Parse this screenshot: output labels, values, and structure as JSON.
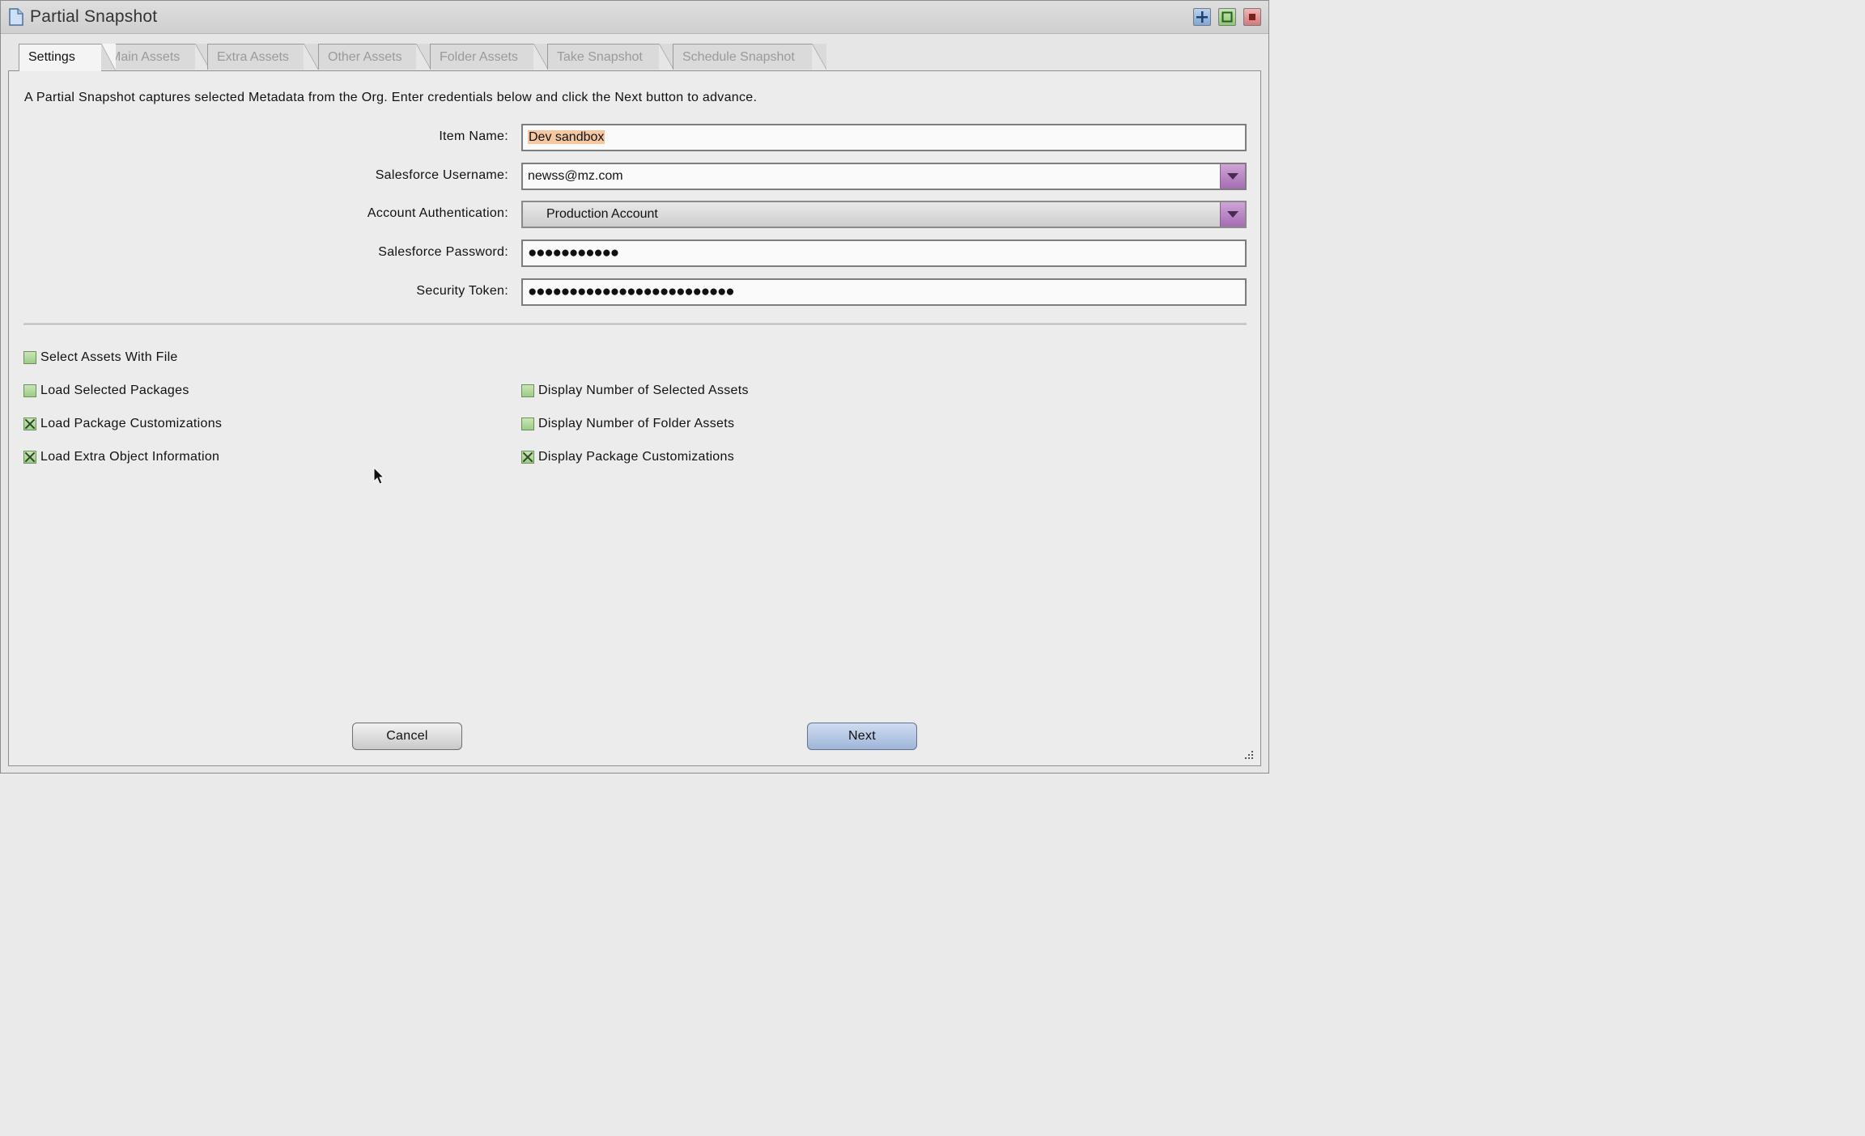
{
  "window": {
    "title": "Partial Snapshot"
  },
  "tabs": [
    {
      "label": "Settings",
      "active": true
    },
    {
      "label": "Main Assets",
      "active": false
    },
    {
      "label": "Extra Assets",
      "active": false
    },
    {
      "label": "Other Assets",
      "active": false
    },
    {
      "label": "Folder Assets",
      "active": false
    },
    {
      "label": "Take Snapshot",
      "active": false
    },
    {
      "label": "Schedule Snapshot",
      "active": false
    }
  ],
  "intro": "A Partial Snapshot captures selected Metadata from the Org. Enter credentials below and click the Next button to advance.",
  "form": {
    "item_name": {
      "label": "Item Name:",
      "value": "Dev sandbox"
    },
    "username": {
      "label": "Salesforce Username:",
      "value": "newss@mz.com"
    },
    "auth": {
      "label": "Account Authentication:",
      "value": "Production Account"
    },
    "password": {
      "label": "Salesforce Password:",
      "value": "●●●●●●●●●●●"
    },
    "token": {
      "label": "Security Token:",
      "value": "●●●●●●●●●●●●●●●●●●●●●●●●●"
    }
  },
  "options": {
    "select_assets_with_file": {
      "label": "Select Assets With File",
      "checked": false
    },
    "load_selected_packages": {
      "label": "Load Selected Packages",
      "checked": false
    },
    "load_package_customizations": {
      "label": "Load Package Customizations",
      "checked": true
    },
    "load_extra_object_information": {
      "label": "Load Extra Object Information",
      "checked": true
    },
    "display_number_selected_assets": {
      "label": "Display Number of Selected Assets",
      "checked": false
    },
    "display_number_folder_assets": {
      "label": "Display Number of Folder Assets",
      "checked": false
    },
    "display_package_customizations": {
      "label": "Display Package Customizations",
      "checked": true
    }
  },
  "buttons": {
    "cancel": "Cancel",
    "next": "Next"
  },
  "colors": {
    "tab_active_bg": "#f4f4f4",
    "selection_highlight": "#f6c8a2",
    "combo_arrow": "#b07ec0",
    "checkbox_green": "#9ccc85",
    "next_button": "#9fb6d9"
  },
  "icons": {
    "title": "document-icon",
    "window_buttons": [
      "add-icon",
      "maximize-icon",
      "close-icon"
    ],
    "resize": "resize-grip-icon"
  }
}
